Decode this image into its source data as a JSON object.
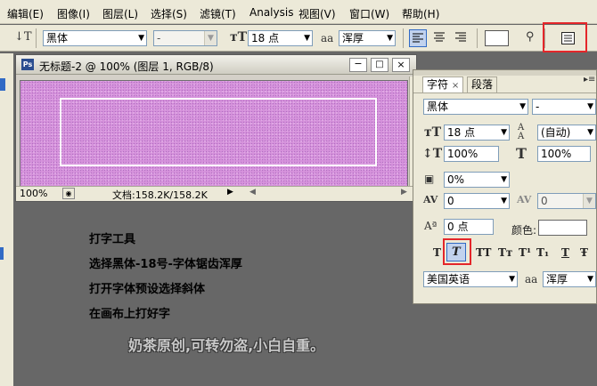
{
  "menubar": {
    "items": [
      "编辑(E)",
      "图像(I)",
      "图层(L)",
      "选择(S)",
      "滤镜(T)",
      "Analysis",
      "视图(V)",
      "窗口(W)",
      "帮助(H)"
    ]
  },
  "options_bar": {
    "font_family": "黑体",
    "font_style": "-",
    "font_size": "18 点",
    "antialias_label": "aa",
    "antialias": "浑厚"
  },
  "document": {
    "title": "无标题-2 @ 100% (图层 1, RGB/8)",
    "ps_badge": "Ps",
    "zoom": "100%",
    "doc_info": "文档:158.2K/158.2K"
  },
  "character_panel": {
    "tabs": [
      "字符",
      "段落"
    ],
    "tab_close": "×",
    "font_family": "黑体",
    "font_style": "-",
    "font_size": "18 点",
    "leading": "(自动)",
    "vertical_scale": "100%",
    "horizontal_scale": "100%",
    "tsume": "0%",
    "kerning": "0",
    "tracking": "0",
    "baseline_shift": "0 点",
    "color_label": "颜色:",
    "language": "美国英语",
    "antialias_label": "aa",
    "antialias": "浑厚",
    "style_buttons": [
      "T",
      "T",
      "TT",
      "Tт",
      "T¹",
      "T₁",
      "T",
      "Ŧ"
    ]
  },
  "instructions": [
    "打字工具",
    "选择黑体-18号-字体锯齿浑厚",
    "打开字体预设选择斜体",
    "在画布上打好字"
  ],
  "watermark": "奶茶原创,可转勿盗,小白自重。",
  "colors": {
    "workspace": "#676767",
    "chrome": "#ece9d8",
    "highlight": "#e4262a",
    "canvas": "#d693dc"
  }
}
